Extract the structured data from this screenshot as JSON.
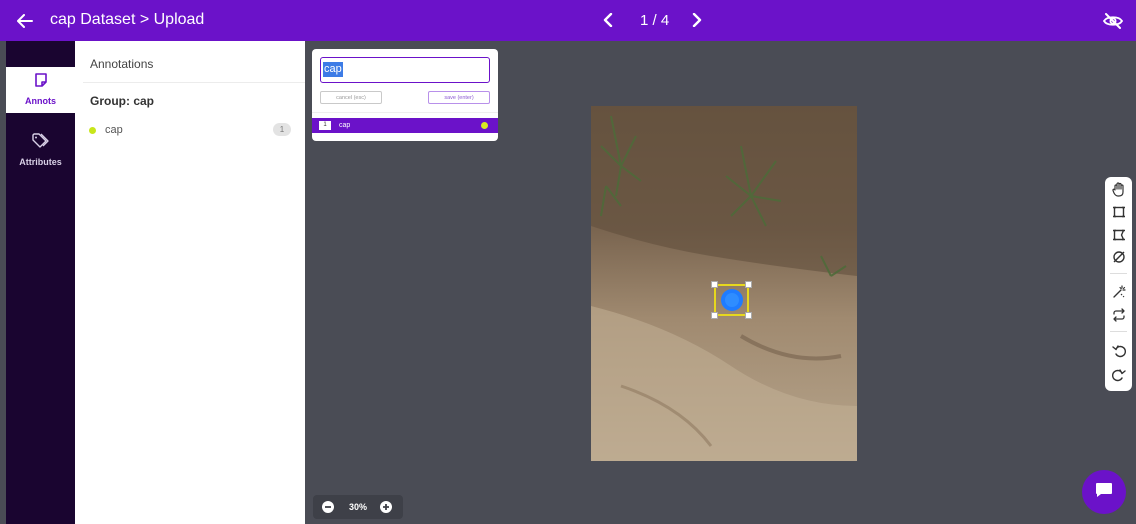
{
  "header": {
    "breadcrumb": "cap Dataset > Upload",
    "page_counter": "1 / 4"
  },
  "rail": {
    "items": [
      {
        "label": "Annots",
        "icon": "note-icon",
        "active": true
      },
      {
        "label": "Attributes",
        "icon": "tags-icon",
        "active": false
      }
    ]
  },
  "panel": {
    "title": "Annotations",
    "group_title": "Group: cap",
    "annotations": [
      {
        "name": "cap",
        "count": "1",
        "color": "#c8e61a"
      }
    ]
  },
  "label_popup": {
    "input_value": "cap",
    "cancel_label": "cancel (esc)",
    "save_label": "save (enter)",
    "options": [
      {
        "key": "1",
        "name": "cap",
        "color": "#d9e820"
      }
    ]
  },
  "zoom": {
    "value": "30%"
  },
  "colors": {
    "accent": "#6b12c9",
    "canvas": "#4a4c55",
    "bbox": "#e6d71e"
  }
}
